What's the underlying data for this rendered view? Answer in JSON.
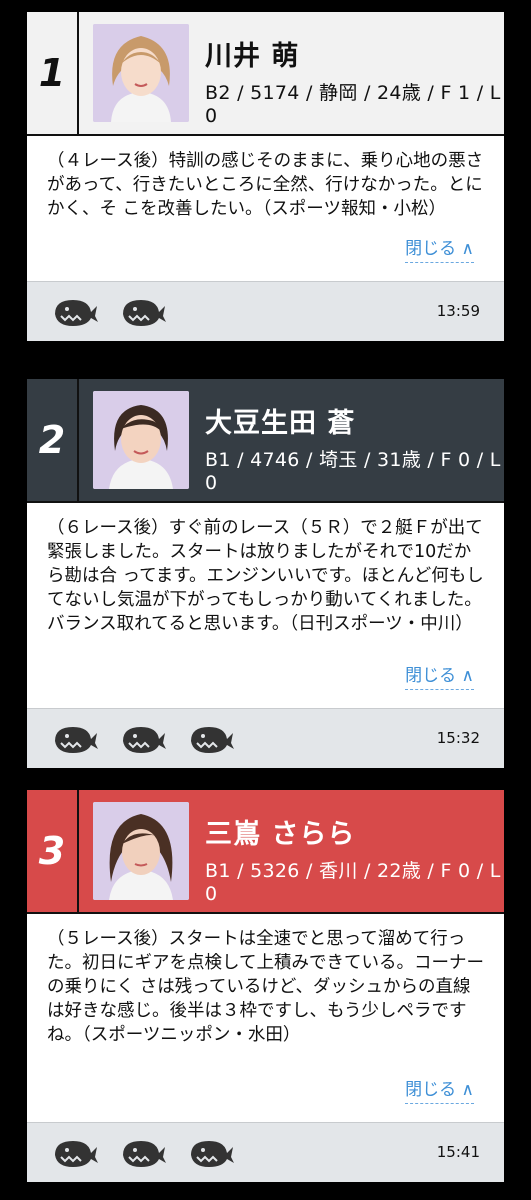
{
  "racers": [
    {
      "number": "1",
      "name": "川井 萌",
      "info": "B2 / 5174 / 静岡 / 24歳 / F 1 / L 0",
      "comment": "（４レース後）特訓の感じそのままに、乗り心地の悪さがあって、行きたいところに全然、行けなかった。とにかく、そ こを改善したい。（スポーツ報知・小松）",
      "close_label": "閉じる ∧",
      "time": "13:59",
      "rating_icons": 2,
      "header_color": "#f2f2f2"
    },
    {
      "number": "2",
      "name": "大豆生田 蒼",
      "info": "B1 / 4746 / 埼玉 / 31歳 / F 0 / L 0",
      "comment": "（６レース後）すぐ前のレース（５Ｒ）で２艇Ｆが出て緊張しました。スタートは放りましたがそれで10だから勘は合 ってます。エンジンいいです。ほとんど何もしてないし気温が下がってもしっかり動いてくれました。バランス取れてると思います。（日刊スポーツ・中川）",
      "close_label": "閉じる ∧",
      "time": "15:32",
      "rating_icons": 3,
      "header_color": "#353d44"
    },
    {
      "number": "3",
      "name": "三嶌 さらら",
      "info": "B1 / 5326 / 香川 / 22歳 / F 0 / L 0",
      "comment": "（５レース後）スタートは全速でと思って溜めて行った。初日にギアを点検して上積みできている。コーナーの乗りにく さは残っているけど、ダッシュからの直線は好きな感じ。後半は３枠ですし、もう少しペラですね。（スポーツニッポン・水田）",
      "close_label": "閉じる ∧",
      "time": "15:41",
      "rating_icons": 3,
      "header_color": "#d74a4a"
    }
  ],
  "icons": {
    "rating": "whale-icon"
  }
}
